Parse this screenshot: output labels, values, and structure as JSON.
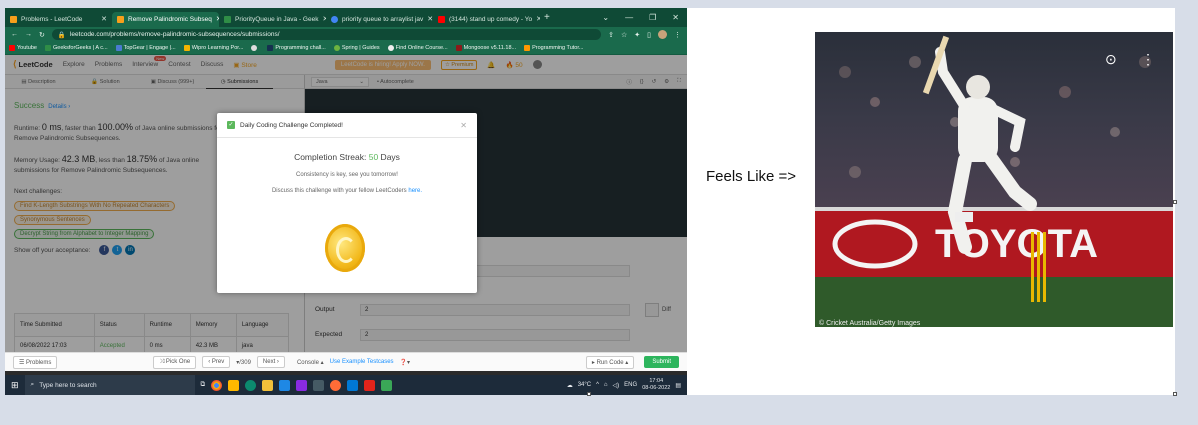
{
  "browser": {
    "tabs": [
      {
        "label": "Problems - LeetCode",
        "color": "#f89f1b"
      },
      {
        "label": "Remove Palindromic Subseq",
        "color": "#f89f1b"
      },
      {
        "label": "PriorityQueue in Java - Geek",
        "color": "#2f8d46"
      },
      {
        "label": "priority queue to arraylist jav",
        "color": "#4285f4"
      },
      {
        "label": "(3144) stand up comedy - Yo",
        "color": "#ff0000"
      }
    ],
    "url": "leetcode.com/problems/remove-palindromic-subsequences/submissions/",
    "bookmarks": [
      "Youtube",
      "GeeksforGeeks | A c...",
      "TopGear | Engage |...",
      "Wipro Learning Por...",
      "",
      "Programming chall...",
      "Spring | Guides",
      "Find Online Course...",
      "Mongoose v5.11.18...",
      "Programming Tutor..."
    ]
  },
  "leetcode": {
    "logo": "LeetCode",
    "nav": [
      "Explore",
      "Problems",
      "Interview",
      "Contest",
      "Discuss",
      "Store"
    ],
    "new_badge": "New",
    "banner": "LeetCode is hiring! Apply NOW.",
    "premium": "Premium",
    "coins": "50",
    "left_tabs": [
      "Description",
      "Solution",
      "Discuss (999+)",
      "Submissions"
    ],
    "status": "Success",
    "details": "Details ›",
    "runtime_prefix": "Runtime: ",
    "runtime_value": "0 ms",
    "runtime_mid": ", faster than ",
    "runtime_pct": "100.00%",
    "runtime_suffix": " of Java online submissions for Remove Palindromic Subsequences.",
    "mem_prefix": "Memory Usage: ",
    "mem_value": "42.3 MB",
    "mem_mid": ", less than ",
    "mem_pct": "18.75%",
    "mem_suffix": " of Java online submissions for Remove Palindromic Subsequences.",
    "next_label": "Next challenges:",
    "challenges": [
      "Find K-Length Substrings With No Repeated Characters",
      "Synonymous Sentences",
      "Decrypt String from Alphabet to Integer Mapping"
    ],
    "share_label": "Show off your acceptance:",
    "table": {
      "headers": [
        "Time Submitted",
        "Status",
        "Runtime",
        "Memory",
        "Language"
      ],
      "row": [
        "06/08/2022 17:03",
        "Accepted",
        "0 ms",
        "42.3 MB",
        "java"
      ]
    },
    "language": "Java",
    "autocomplete": "Autocomplete",
    "output_label": "Output",
    "output_value": "2",
    "expected_label": "Expected",
    "expected_value": "2",
    "diff": "Diff",
    "bottom": {
      "problems": "Problems",
      "pick_one": "Pick One",
      "prev": "Prev",
      "page": "/309",
      "next": "Next",
      "console": "Console",
      "use_example": "Use Example Testcases",
      "run": "Run Code",
      "submit": "Submit"
    }
  },
  "modal": {
    "title": "Daily Coding Challenge Completed!",
    "streak_prefix": "Completion Streak: ",
    "streak_value": "50",
    "streak_suffix": " Days",
    "line1": "Consistency is key, see you tomorrow!",
    "line2_prefix": "Discuss this challenge with your fellow LeetCoders ",
    "line2_link": "here."
  },
  "taskbar": {
    "search": "Type here to search",
    "temp": "34°C",
    "lang": "ENG",
    "time": "17:04",
    "date": "08-06-2022"
  },
  "caption": "Feels Like =>",
  "photo": {
    "sponsor": "TOYOTA",
    "credit": "© Cricket Australia/Getty Images"
  }
}
